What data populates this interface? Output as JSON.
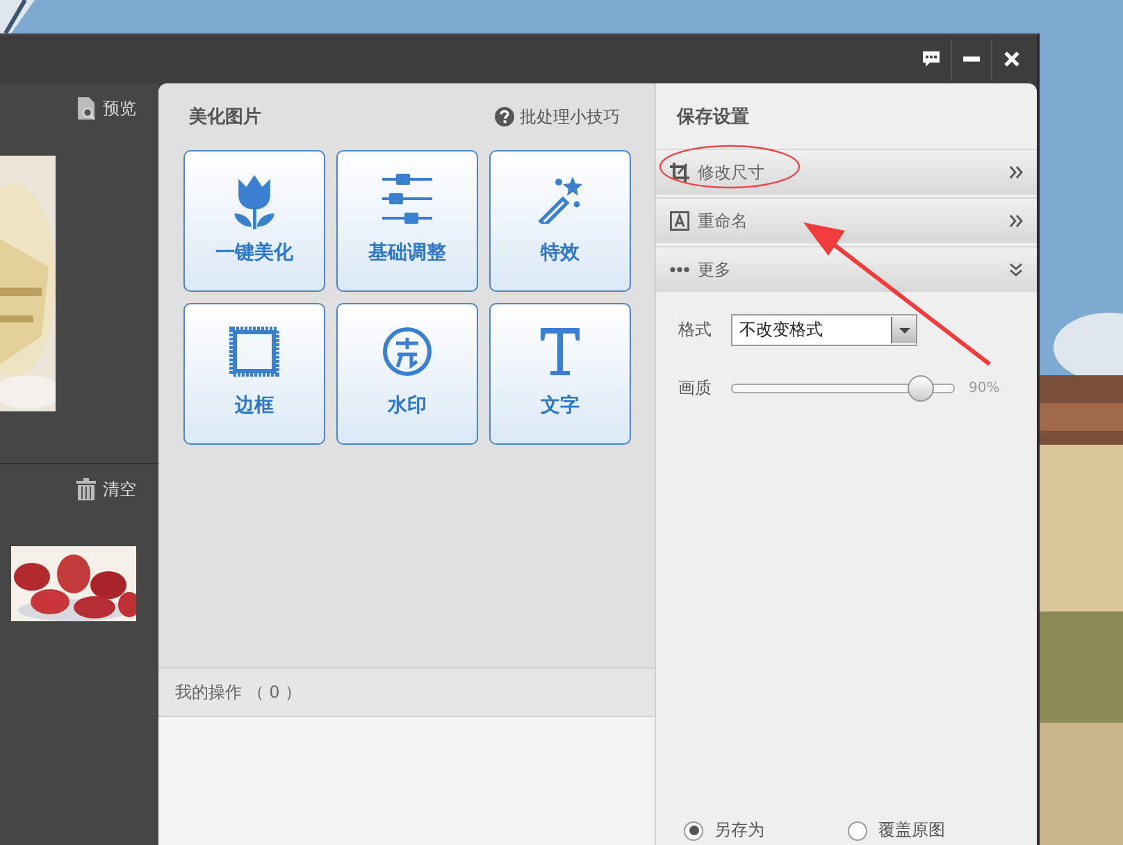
{
  "left_panel": {
    "preview_label": "预览",
    "clear_label": "清空"
  },
  "beautify": {
    "title": "美化图片",
    "tip": "批处理小技巧",
    "tools": [
      {
        "label": "一键美化",
        "kind": "tulip"
      },
      {
        "label": "基础调整",
        "kind": "sliders"
      },
      {
        "label": "特效",
        "kind": "wand"
      },
      {
        "label": "边框",
        "kind": "frame"
      },
      {
        "label": "水印",
        "kind": "stamp"
      },
      {
        "label": "文字",
        "kind": "text"
      }
    ],
    "history": {
      "label": "我的操作 （ 0 ）"
    }
  },
  "save_settings": {
    "title": "保存设置",
    "sections": [
      {
        "label": "修改尺寸",
        "kind": "resize",
        "expanded": false
      },
      {
        "label": "重命名",
        "kind": "rename",
        "expanded": false
      },
      {
        "label": "更多",
        "kind": "more",
        "expanded": true
      }
    ],
    "format": {
      "label": "格式",
      "value": "不改变格式"
    },
    "quality": {
      "label": "画质",
      "level": 0.85,
      "reading": "90%"
    },
    "save_mode": [
      {
        "label": "另存为",
        "selected": true
      },
      {
        "label": "覆盖原图",
        "selected": false
      }
    ]
  }
}
